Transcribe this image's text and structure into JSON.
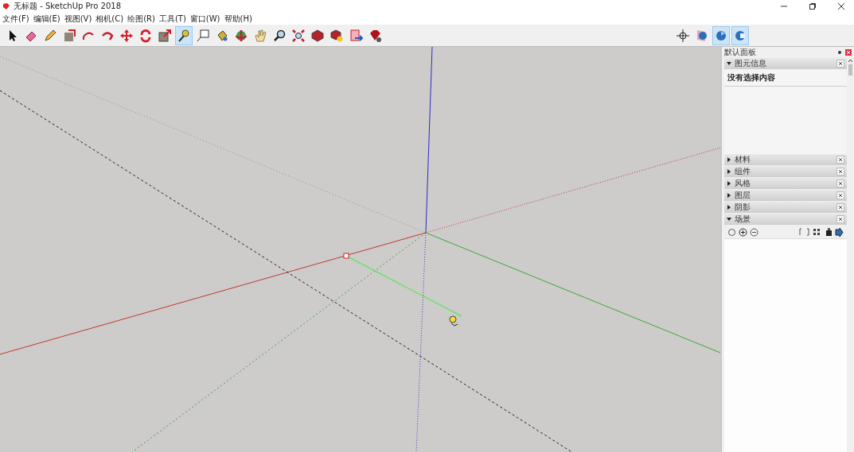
{
  "window": {
    "title": "无标题 - SketchUp Pro 2018"
  },
  "menu": [
    "文件(F)",
    "编辑(E)",
    "视图(V)",
    "相机(C)",
    "绘图(R)",
    "工具(T)",
    "窗口(W)",
    "帮助(H)"
  ],
  "toolbar": [
    {
      "kind": "select",
      "selected": false
    },
    {
      "kind": "eraser",
      "selected": false
    },
    {
      "kind": "pencil",
      "selected": false
    },
    {
      "kind": "push",
      "selected": false
    },
    {
      "kind": "arc",
      "selected": false
    },
    {
      "kind": "followme",
      "selected": false
    },
    {
      "kind": "move",
      "selected": false
    },
    {
      "kind": "rotate",
      "selected": false
    },
    {
      "kind": "scale",
      "selected": false
    },
    {
      "kind": "tape",
      "selected": true
    },
    {
      "kind": "text",
      "selected": false
    },
    {
      "kind": "bucket",
      "selected": false
    },
    {
      "kind": "orbit",
      "selected": false
    },
    {
      "kind": "pan",
      "selected": false
    },
    {
      "kind": "zoom",
      "selected": false
    },
    {
      "kind": "extents",
      "selected": false
    },
    {
      "kind": "warehouse",
      "selected": false
    },
    {
      "kind": "share",
      "selected": false
    },
    {
      "kind": "layout",
      "selected": false
    },
    {
      "kind": "ruby",
      "selected": false
    }
  ],
  "toolbar_right": [
    {
      "kind": "axes",
      "selected": false
    },
    {
      "kind": "section",
      "selected": false
    },
    {
      "kind": "fill",
      "selected": true
    },
    {
      "kind": "cut",
      "selected": true
    }
  ],
  "panel": {
    "title": "默认面板",
    "sections": [
      {
        "title": "图元信息",
        "expanded": true,
        "kind": "info",
        "text": "没有选择内容"
      },
      {
        "title": "材料",
        "expanded": false
      },
      {
        "title": "组件",
        "expanded": false
      },
      {
        "title": "风格",
        "expanded": false
      },
      {
        "title": "图层",
        "expanded": false
      },
      {
        "title": "阴影",
        "expanded": false
      },
      {
        "title": "场景",
        "expanded": true,
        "kind": "scenes"
      }
    ]
  }
}
